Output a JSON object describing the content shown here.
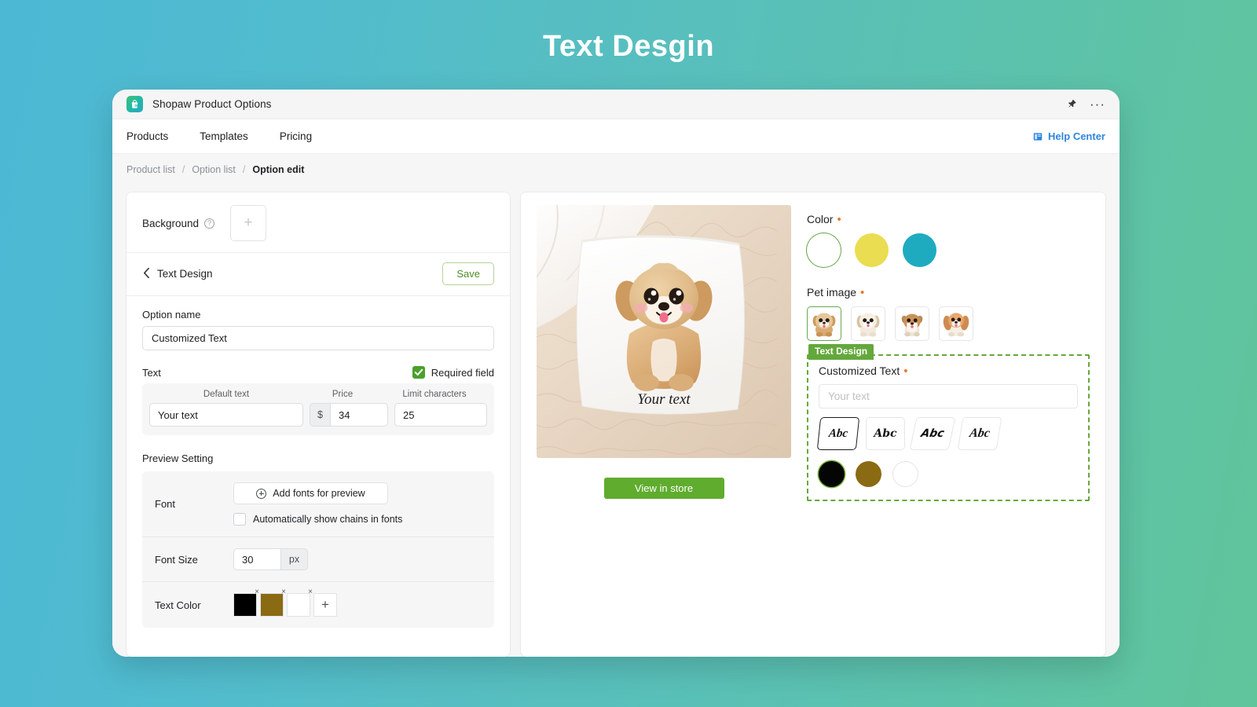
{
  "banner": {
    "title": "Text Desgin"
  },
  "titlebar": {
    "app_name": "Shopaw Product Options",
    "logo_icon": "shopping-bag-icon",
    "pin_icon": "pin-icon",
    "more_icon": "more-options-icon"
  },
  "nav": {
    "tabs": [
      {
        "label": "Products"
      },
      {
        "label": "Templates"
      },
      {
        "label": "Pricing"
      }
    ],
    "help": {
      "label": "Help Center",
      "icon": "book-icon",
      "color": "#2e84e0"
    }
  },
  "breadcrumb": {
    "items": [
      {
        "label": "Product list",
        "active": false
      },
      {
        "label": "Option list",
        "active": false
      },
      {
        "label": "Option edit",
        "active": true
      }
    ],
    "separator": "/"
  },
  "left_panel": {
    "background": {
      "label": "Background",
      "help_icon": "question-mark-icon",
      "add_icon": "plus-icon"
    },
    "section": {
      "back_icon": "chevron-left-icon",
      "title": "Text Design",
      "save_label": "Save",
      "save_color": "#4e8c2a"
    },
    "option_name": {
      "label": "Option name",
      "value": "Customized Text"
    },
    "text_block": {
      "label": "Text",
      "required_label": "Required field",
      "required_checked": true,
      "columns": [
        "Default text",
        "Price",
        "Limit characters"
      ],
      "default_text": "Your text",
      "price_prefix": "$",
      "price": "34",
      "limit_characters": "25"
    },
    "preview_setting": {
      "title": "Preview Setting",
      "rows": [
        {
          "label": "Font"
        },
        {
          "label": "Font Size"
        },
        {
          "label": "Text Color"
        }
      ],
      "add_fonts_label": "Add fonts for preview",
      "add_fonts_icon": "plus-circle-icon",
      "chains_label": "Automatically show chains in fonts",
      "chains_checked": false,
      "font_size": "30",
      "font_size_unit": "px",
      "text_colors": [
        "#000000",
        "#8a6a13",
        "#ffffff"
      ],
      "remove_icon": "close-x-icon",
      "add_color_icon": "plus-icon"
    }
  },
  "right_panel": {
    "preview": {
      "product_text": "Your text",
      "view_in_store_label": "View in store",
      "view_in_store_color": "#5fac2e"
    },
    "color_option": {
      "label": "Color",
      "required": true,
      "swatches": [
        {
          "hex": "#ffffff",
          "selected": true
        },
        {
          "hex": "#eadd51",
          "selected": false
        },
        {
          "hex": "#1eabc0",
          "selected": false
        }
      ]
    },
    "pet_option": {
      "label": "Pet image",
      "required": true,
      "items": [
        {
          "name": "golden-puppy",
          "selected": true
        },
        {
          "name": "shih-tzu-puppy",
          "selected": false
        },
        {
          "name": "bulldog-puppy",
          "selected": false
        },
        {
          "name": "spaniel-puppy",
          "selected": false
        }
      ]
    },
    "text_design": {
      "badge": "Text Design",
      "badge_color": "#64a83c",
      "label": "Customized Text",
      "required": true,
      "input_placeholder": "Your text",
      "input_value": "",
      "font_styles": [
        {
          "sample": "Abc",
          "selected": true
        },
        {
          "sample": "Abc",
          "selected": false
        },
        {
          "sample": "Abc",
          "selected": false
        },
        {
          "sample": "Abc",
          "selected": false
        }
      ],
      "text_colors": [
        {
          "hex": "#050505",
          "selected": true
        },
        {
          "hex": "#8a6a13",
          "selected": false
        },
        {
          "hex": "#ffffff",
          "selected": false
        }
      ]
    }
  },
  "theme": {
    "bg_gradient_from": "#4cb8d4",
    "bg_gradient_to": "#60c59b",
    "accent_green": "#64a83c",
    "accent_blue": "#2e84e0"
  }
}
